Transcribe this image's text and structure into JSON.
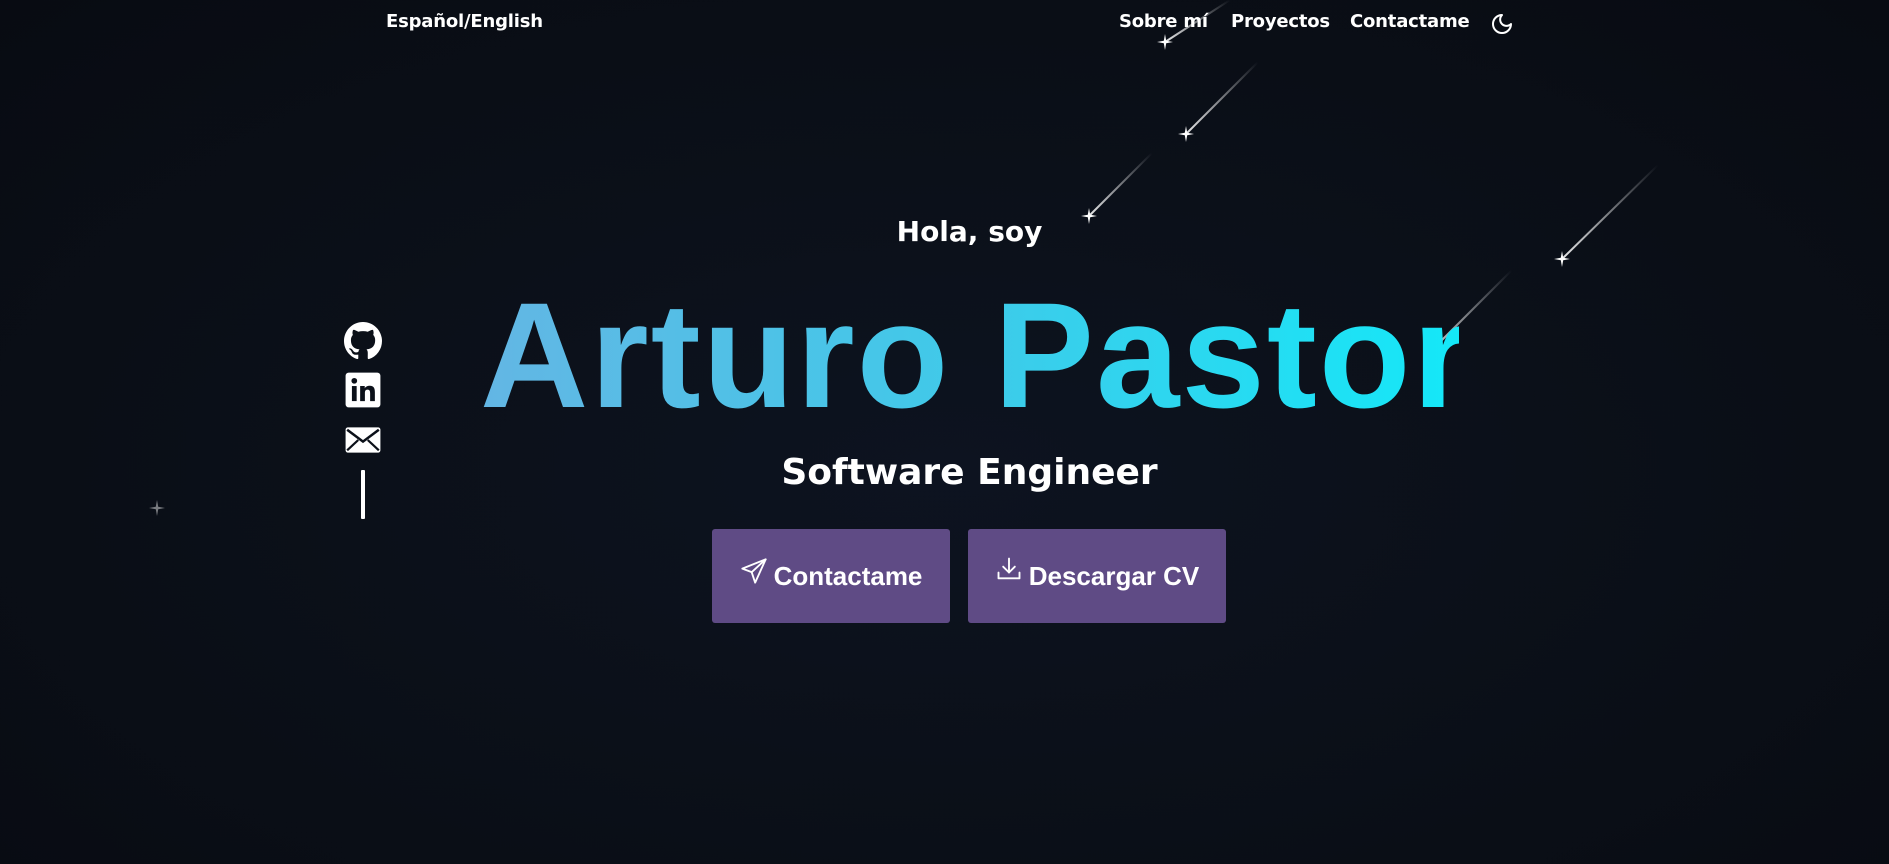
{
  "header": {
    "language_toggle": "Español/English",
    "nav": {
      "about": "Sobre mí",
      "projects": "Proyectos",
      "contact": "Contactame"
    },
    "theme_toggle_icon": "moon-icon"
  },
  "social": {
    "items": [
      {
        "name": "github",
        "icon": "github-icon"
      },
      {
        "name": "linkedin",
        "icon": "linkedin-icon"
      },
      {
        "name": "email",
        "icon": "mail-icon"
      }
    ]
  },
  "hero": {
    "greeting": "Hola, soy",
    "name": "Arturo Pastor",
    "role": "Software Engineer",
    "buttons": {
      "contact": {
        "label": "Contactame",
        "icon": "send-icon"
      },
      "cv": {
        "label": "Descargar CV",
        "icon": "download-icon"
      }
    }
  },
  "colors": {
    "background": "#0b1019",
    "name_gradient_start": "#63b6e4",
    "name_gradient_end": "#14e8f8",
    "button": "#5f4b85",
    "text": "#ffffff"
  }
}
